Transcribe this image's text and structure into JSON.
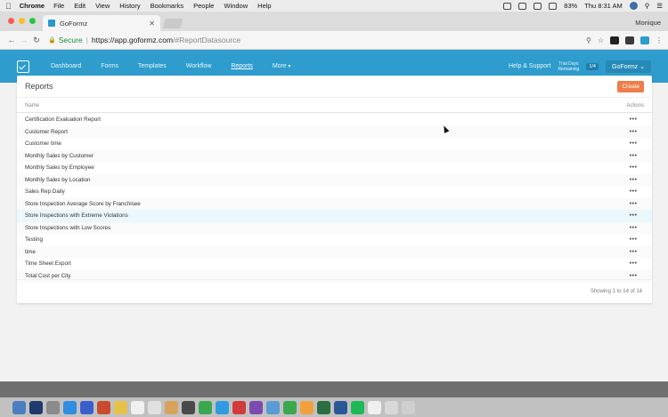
{
  "menubar": {
    "app_name": "Chrome",
    "items": [
      "File",
      "Edit",
      "View",
      "History",
      "Bookmarks",
      "People",
      "Window",
      "Help"
    ],
    "battery": "83%",
    "clock": "Thu 8:31 AM"
  },
  "browser": {
    "tab_title": "GoFormz",
    "profile_name": "Monique",
    "secure_label": "Secure",
    "url_host": "https://app.goformz.com",
    "url_path": "/#ReportDatasource"
  },
  "app": {
    "nav": [
      "Dashboard",
      "Forms",
      "Templates",
      "Workflow",
      "Reports",
      "More"
    ],
    "active_nav": "Reports",
    "help_label": "Help & Support",
    "trial_line1": "Trial Days",
    "trial_line2": "Remaining",
    "trial_count": "1/4",
    "org_label": "GoFormz",
    "brand_color": "#2e9ccc",
    "accent_color": "#ef7d4a"
  },
  "reports": {
    "title": "Reports",
    "create_label": "Create",
    "col_name": "Name",
    "col_actions": "Actions",
    "rows": [
      "Certification Evaluation Report",
      "Customer Report",
      "Customer time",
      "Monthly Sales by Customer",
      "Monthly Sales by Employee",
      "Monthly Sales by Location",
      "Sales Rep Daily",
      "Store Inspection Average Score by Franchisee",
      "Store Inspections with Extreme Violations",
      "Store Inspections with Low Scores",
      "Testing",
      "time",
      "Time Sheet Export",
      "Total Cost per City"
    ],
    "row_action": "•••",
    "pager": "Showing 1 to 14 of 14"
  }
}
